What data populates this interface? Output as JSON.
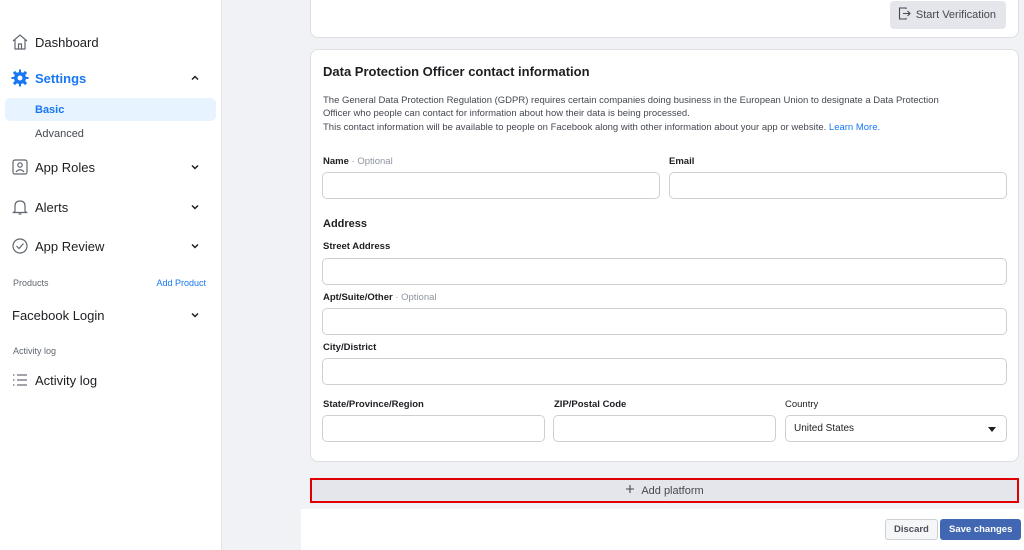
{
  "sidebar": {
    "dashboard": "Dashboard",
    "settings": "Settings",
    "settings_sub": [
      "Basic",
      "Advanced"
    ],
    "app_roles": "App Roles",
    "alerts": "Alerts",
    "app_review": "App Review",
    "products_label": "Products",
    "add_product": "Add Product",
    "facebook_login": "Facebook Login",
    "activity_log_label": "Activity log",
    "activity_log": "Activity log"
  },
  "top_card": {
    "start_verification": "Start Verification"
  },
  "dpo": {
    "title": "Data Protection Officer contact information",
    "desc_line1": "The General Data Protection Regulation (GDPR) requires certain companies doing business in the European Union to designate a Data Protection",
    "desc_line2": "Officer who people can contact for information about how their data is being processed.",
    "desc_line3": "This contact information will be available to people on Facebook along with other information about your app or website. ",
    "learn_more": "Learn More.",
    "name_label": "Name",
    "optional": " · Optional",
    "email_label": "Email",
    "address_heading": "Address",
    "street_label": "Street Address",
    "apt_label": "Apt/Suite/Other",
    "city_label": "City/District",
    "state_label": "State/Province/Region",
    "zip_label": "ZIP/Postal Code",
    "country_label": "Country",
    "country_value": "United States"
  },
  "add_platform": "Add platform",
  "footer": {
    "discard": "Discard",
    "save": "Save changes"
  },
  "colors": {
    "accent": "#1877f2",
    "save_button": "#4267b2",
    "highlight_border": "#e00000"
  }
}
